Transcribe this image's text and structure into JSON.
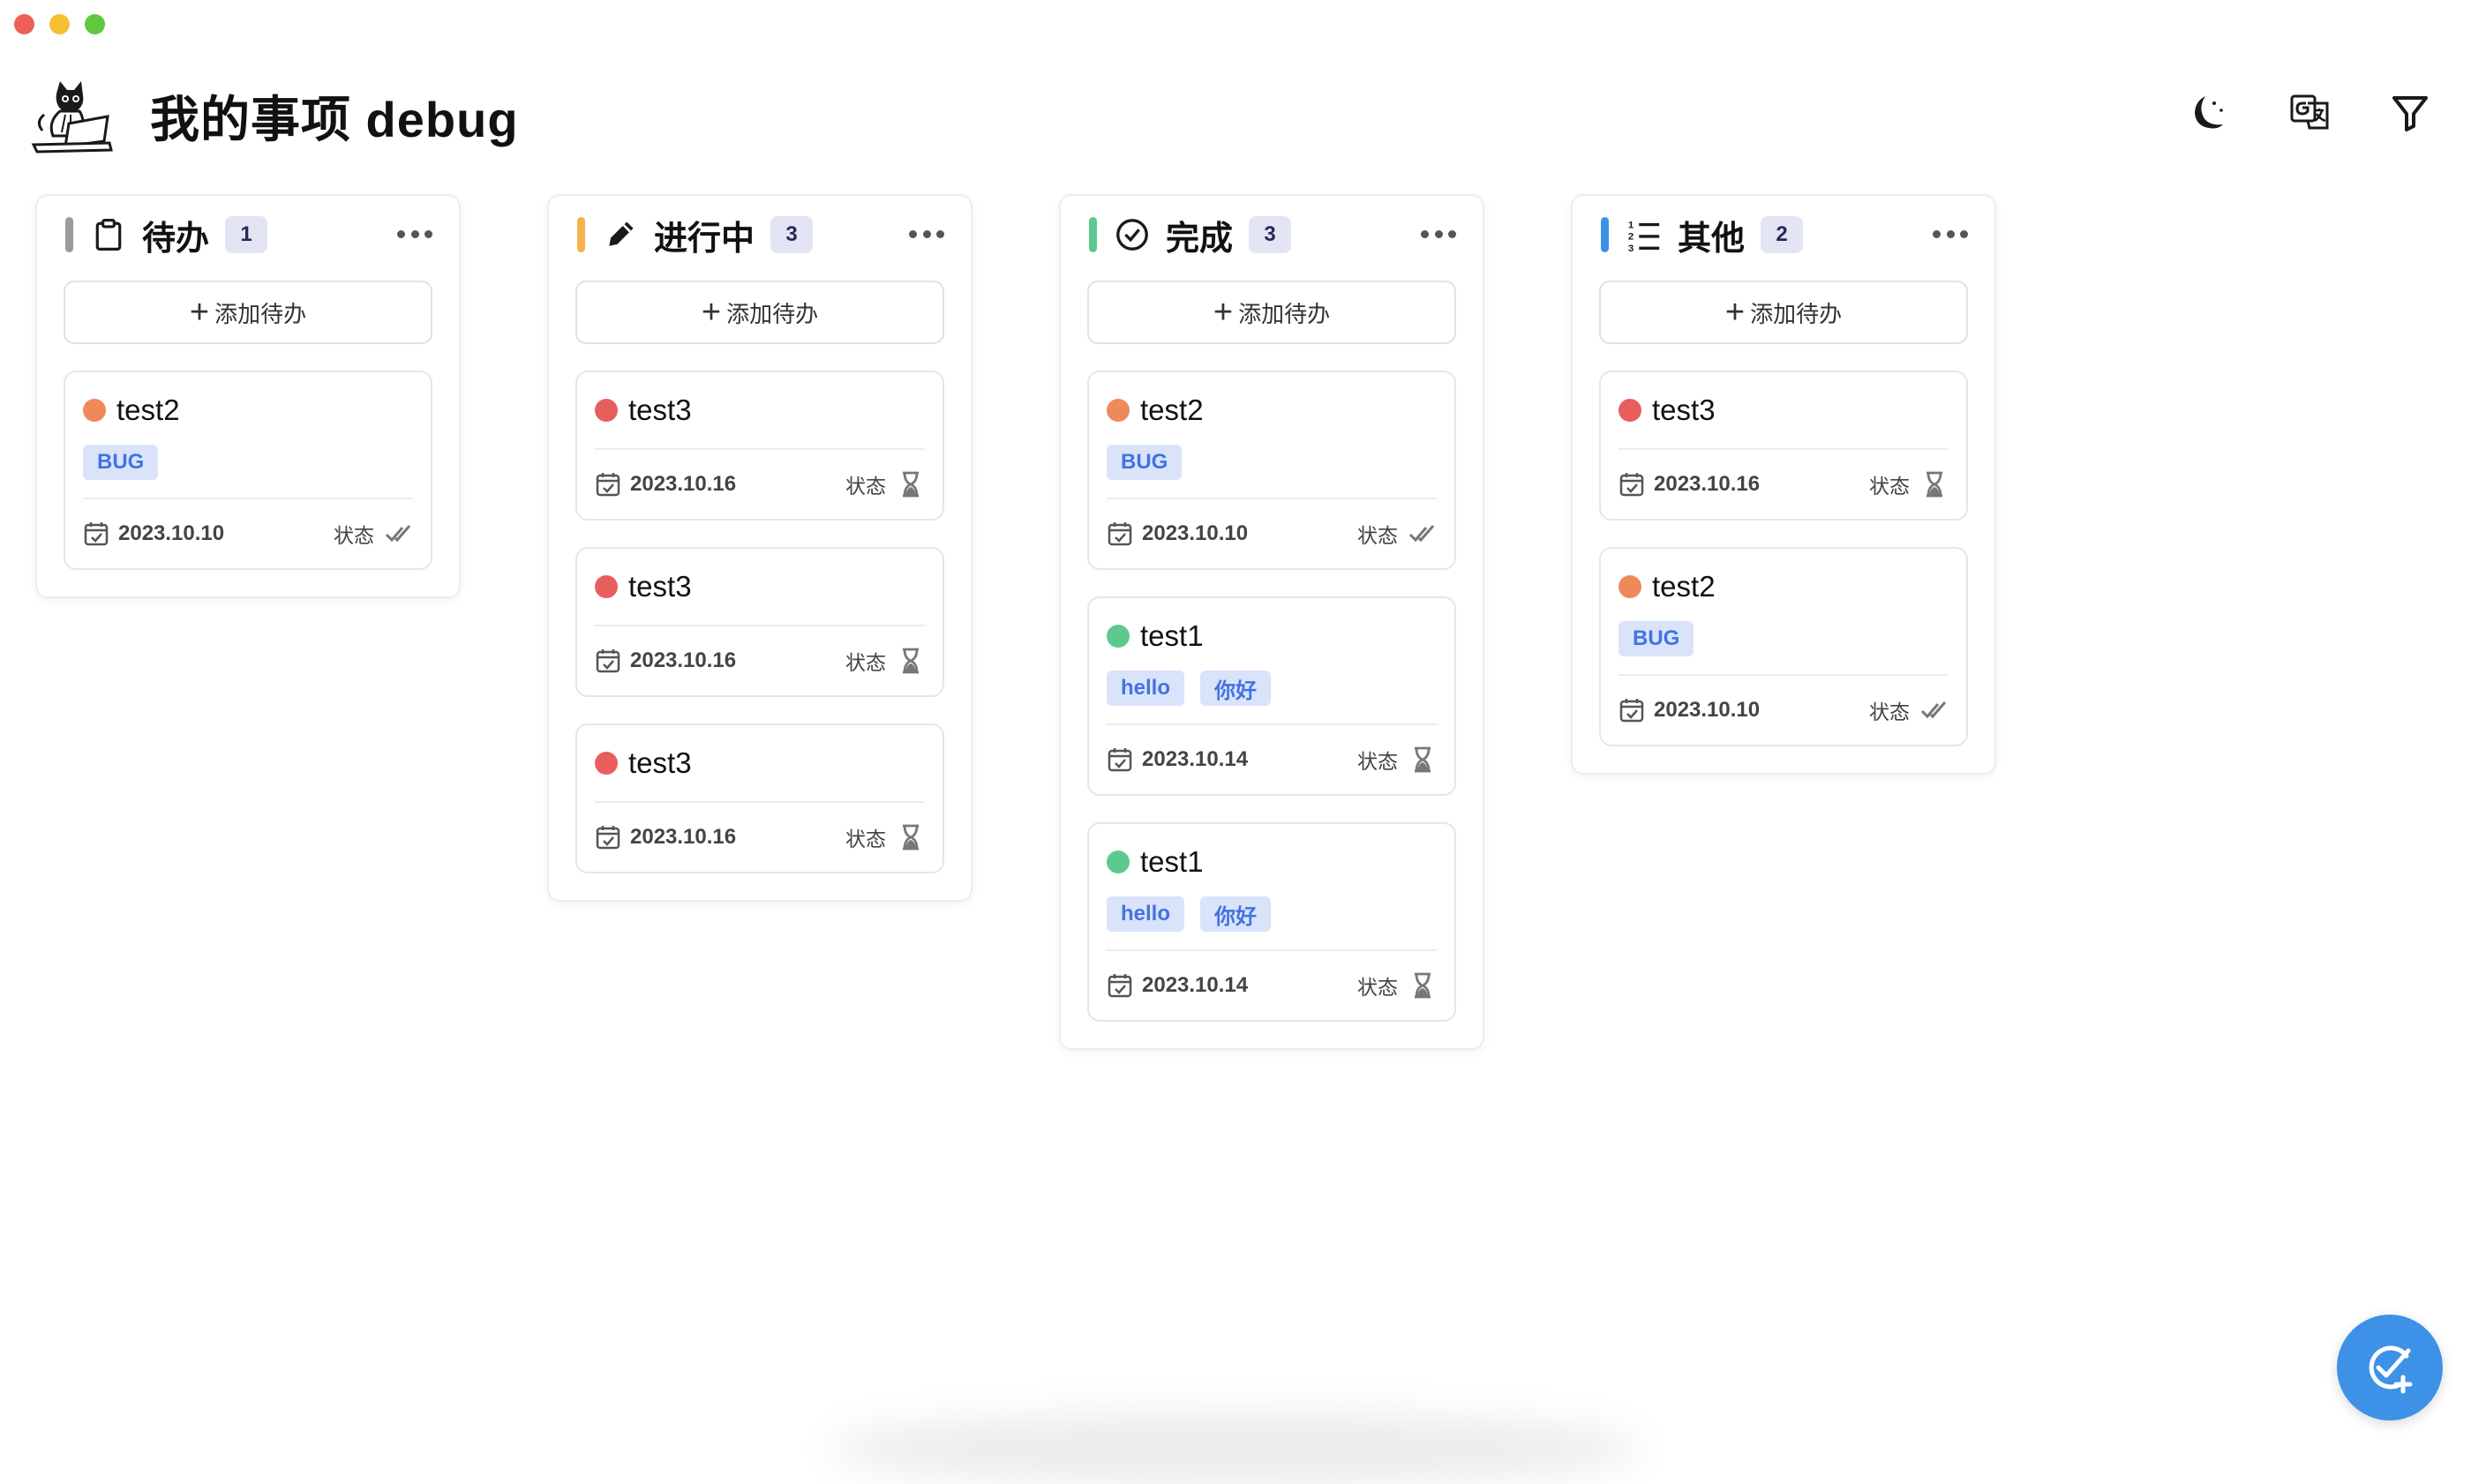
{
  "app": {
    "title": "我的事项 debug"
  },
  "window_controls": {
    "close_color": "#ee5f57",
    "minimize_color": "#f5bf2f",
    "maximize_color": "#5fc740"
  },
  "toolbar": {
    "icons": [
      "moon-icon",
      "translate-icon",
      "filter-icon"
    ]
  },
  "columns": [
    {
      "title": "待办",
      "count": "1",
      "accent": "#9a9a9a",
      "icon": "clipboard-icon",
      "add_label": "添加待办",
      "cards": [
        {
          "title": "test2",
          "priority_color": "#ee8a5a",
          "tags": [
            "BUG"
          ],
          "date": "2023.10.10",
          "status_label": "状态",
          "status_icon": "double-check-icon"
        }
      ]
    },
    {
      "title": "进行中",
      "count": "3",
      "accent": "#f4b24f",
      "icon": "pencil-icon",
      "add_label": "添加待办",
      "cards": [
        {
          "title": "test3",
          "priority_color": "#e85e5e",
          "tags": [],
          "date": "2023.10.16",
          "status_label": "状态",
          "status_icon": "hourglass-icon"
        },
        {
          "title": "test3",
          "priority_color": "#e85e5e",
          "tags": [],
          "date": "2023.10.16",
          "status_label": "状态",
          "status_icon": "hourglass-icon"
        },
        {
          "title": "test3",
          "priority_color": "#e85e5e",
          "tags": [],
          "date": "2023.10.16",
          "status_label": "状态",
          "status_icon": "hourglass-icon"
        }
      ]
    },
    {
      "title": "完成",
      "count": "3",
      "accent": "#5ec98f",
      "icon": "check-circle-icon",
      "add_label": "添加待办",
      "cards": [
        {
          "title": "test2",
          "priority_color": "#ee8a5a",
          "tags": [
            "BUG"
          ],
          "date": "2023.10.10",
          "status_label": "状态",
          "status_icon": "double-check-icon"
        },
        {
          "title": "test1",
          "priority_color": "#5ec98f",
          "tags": [
            "hello",
            "你好"
          ],
          "date": "2023.10.14",
          "status_label": "状态",
          "status_icon": "hourglass-icon"
        },
        {
          "title": "test1",
          "priority_color": "#5ec98f",
          "tags": [
            "hello",
            "你好"
          ],
          "date": "2023.10.14",
          "status_label": "状态",
          "status_icon": "hourglass-icon"
        }
      ]
    },
    {
      "title": "其他",
      "count": "2",
      "accent": "#3d92e8",
      "icon": "ordered-list-icon",
      "add_label": "添加待办",
      "cards": [
        {
          "title": "test3",
          "priority_color": "#e85e5e",
          "tags": [],
          "date": "2023.10.16",
          "status_label": "状态",
          "status_icon": "hourglass-icon"
        },
        {
          "title": "test2",
          "priority_color": "#ee8a5a",
          "tags": [
            "BUG"
          ],
          "date": "2023.10.10",
          "status_label": "状态",
          "status_icon": "double-check-icon"
        }
      ]
    }
  ],
  "fab": {
    "icon": "add-task-icon",
    "color": "#3d92e8"
  }
}
